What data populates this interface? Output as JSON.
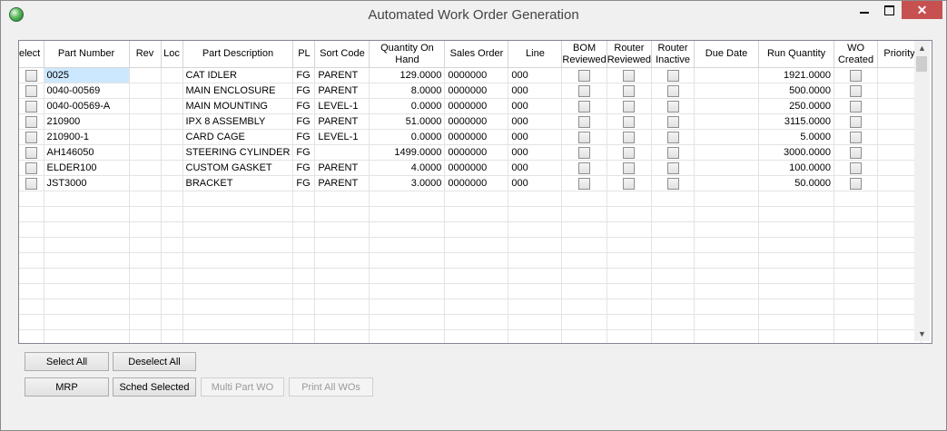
{
  "window": {
    "title": "Automated Work Order Generation",
    "minimize_glyph": "",
    "maximize_glyph": "",
    "close_glyph": "✕"
  },
  "grid": {
    "columns": [
      "elect",
      "Part Number",
      "Rev",
      "Loc",
      "Part Description",
      "PL",
      "Sort Code",
      "Quantity On Hand",
      "Sales Order",
      "Line",
      "BOM Reviewed",
      "Router Reviewed",
      "Router Inactive",
      "Due Date",
      "Run Quantity",
      "WO Created",
      "Priority"
    ],
    "rows": [
      {
        "part": "0025",
        "rev": "",
        "loc": "",
        "desc": "CAT IDLER",
        "pl": "FG",
        "sort": "PARENT",
        "qoh": "129.0000",
        "so": "0000000",
        "line": "000",
        "due": "",
        "run": "1921.0000",
        "priority": ""
      },
      {
        "part": "0040-00569",
        "rev": "",
        "loc": "",
        "desc": "MAIN ENCLOSURE",
        "pl": "FG",
        "sort": "PARENT",
        "qoh": "8.0000",
        "so": "0000000",
        "line": "000",
        "due": "",
        "run": "500.0000",
        "priority": ""
      },
      {
        "part": "0040-00569-A",
        "rev": "",
        "loc": "",
        "desc": "MAIN MOUNTING",
        "pl": "FG",
        "sort": "LEVEL-1",
        "qoh": "0.0000",
        "so": "0000000",
        "line": "000",
        "due": "",
        "run": "250.0000",
        "priority": ""
      },
      {
        "part": "210900",
        "rev": "",
        "loc": "",
        "desc": "IPX 8 ASSEMBLY",
        "pl": "FG",
        "sort": "PARENT",
        "qoh": "51.0000",
        "so": "0000000",
        "line": "000",
        "due": "",
        "run": "3115.0000",
        "priority": ""
      },
      {
        "part": "210900-1",
        "rev": "",
        "loc": "",
        "desc": "CARD CAGE",
        "pl": "FG",
        "sort": "LEVEL-1",
        "qoh": "0.0000",
        "so": "0000000",
        "line": "000",
        "due": "",
        "run": "5.0000",
        "priority": ""
      },
      {
        "part": "AH146050",
        "rev": "",
        "loc": "",
        "desc": "STEERING CYLINDER",
        "pl": "FG",
        "sort": "",
        "qoh": "1499.0000",
        "so": "0000000",
        "line": "000",
        "due": "",
        "run": "3000.0000",
        "priority": ""
      },
      {
        "part": "ELDER100",
        "rev": "",
        "loc": "",
        "desc": "CUSTOM GASKET",
        "pl": "FG",
        "sort": "PARENT",
        "qoh": "4.0000",
        "so": "0000000",
        "line": "000",
        "due": "",
        "run": "100.0000",
        "priority": ""
      },
      {
        "part": "JST3000",
        "rev": "",
        "loc": "",
        "desc": "BRACKET",
        "pl": "FG",
        "sort": "PARENT",
        "qoh": "3.0000",
        "so": "0000000",
        "line": "000",
        "due": "",
        "run": "50.0000",
        "priority": ""
      }
    ]
  },
  "buttons": {
    "select_all": "Select All",
    "deselect_all": "Deselect All",
    "mrp": "MRP",
    "sched_selected": "Sched Selected",
    "multi_part_wo": "Multi Part WO",
    "print_all_wos": "Print All WOs"
  }
}
